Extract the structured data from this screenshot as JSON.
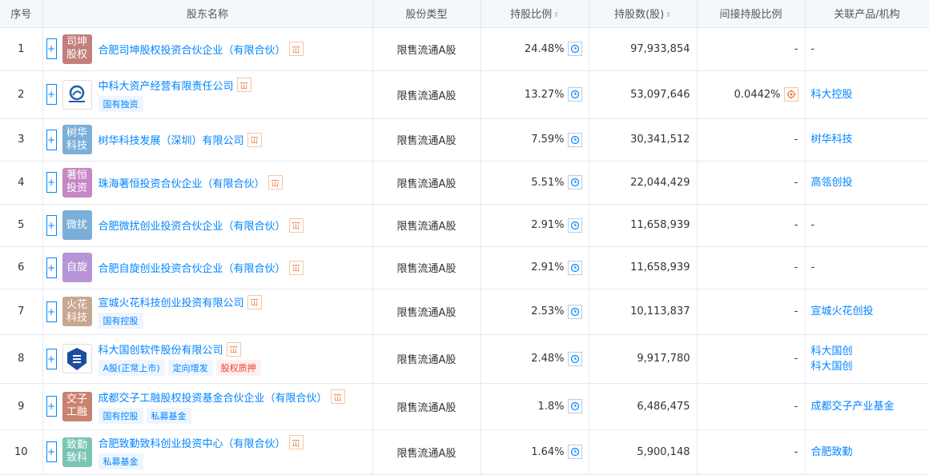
{
  "headers": {
    "idx": "序号",
    "name": "股东名称",
    "type": "股份类型",
    "ratio": "持股比例",
    "shares": "持股数(股)",
    "indirect": "间接持股比例",
    "products": "关联产品/机构"
  },
  "sort_glyph": "⇕",
  "hm_glyph": "冚",
  "rows": [
    {
      "idx": "1",
      "logo": "司坤股权",
      "logo_color": "#c47f7c",
      "name": "合肥司坤股权投资合伙企业（有限合伙）",
      "tags": [],
      "type": "限售流通A股",
      "ratio": "24.48%",
      "shares": "97,933,854",
      "indirect": "-",
      "products": [
        "-"
      ],
      "product_link": false
    },
    {
      "idx": "2",
      "logo": "",
      "logo_image": "ustc-logo-icon",
      "name": "中科大资产经营有限责任公司",
      "tags": [
        "国有独资"
      ],
      "type": "限售流通A股",
      "ratio": "13.27%",
      "shares": "53,097,646",
      "indirect": "0.0442%",
      "products": [
        "科大控股"
      ],
      "product_link": true
    },
    {
      "idx": "3",
      "logo": "树华科技",
      "logo_color": "#7aafd9",
      "name": "树华科技发展（深圳）有限公司",
      "tags": [],
      "type": "限售流通A股",
      "ratio": "7.59%",
      "shares": "30,341,512",
      "indirect": "-",
      "products": [
        "树华科技"
      ],
      "product_link": true
    },
    {
      "idx": "4",
      "logo": "著恒投资",
      "logo_color": "#c786c6",
      "name": "珠海著恒投资合伙企业（有限合伙）",
      "tags": [],
      "type": "限售流通A股",
      "ratio": "5.51%",
      "shares": "22,044,429",
      "indirect": "-",
      "products": [
        "高瓴创投"
      ],
      "product_link": true
    },
    {
      "idx": "5",
      "logo": "微扰",
      "logo_color": "#7aafd9",
      "name": "合肥微扰创业投资合伙企业（有限合伙）",
      "tags": [],
      "type": "限售流通A股",
      "ratio": "2.91%",
      "shares": "11,658,939",
      "indirect": "-",
      "products": [
        "-"
      ],
      "product_link": false
    },
    {
      "idx": "6",
      "logo": "自旋",
      "logo_color": "#b694d6",
      "name": "合肥自旋创业投资合伙企业（有限合伙）",
      "tags": [],
      "type": "限售流通A股",
      "ratio": "2.91%",
      "shares": "11,658,939",
      "indirect": "-",
      "products": [
        "-"
      ],
      "product_link": false
    },
    {
      "idx": "7",
      "logo": "火花科技",
      "logo_color": "#c9a692",
      "name": "宣城火花科技创业投资有限公司",
      "tags": [
        "国有控股"
      ],
      "type": "限售流通A股",
      "ratio": "2.53%",
      "shares": "10,113,837",
      "indirect": "-",
      "products": [
        "宣城火花创投"
      ],
      "product_link": true
    },
    {
      "idx": "8",
      "logo": "",
      "logo_image": "kd-software-logo-icon",
      "name": "科大国创软件股份有限公司",
      "tags": [
        "A股(正常上市)",
        "定向增发",
        "股权质押"
      ],
      "tag_red_index": 2,
      "type": "限售流通A股",
      "ratio": "2.48%",
      "shares": "9,917,780",
      "indirect": "-",
      "products": [
        "科大国创",
        "科大国创"
      ],
      "product_link": true
    },
    {
      "idx": "9",
      "logo": "交子工融",
      "logo_color": "#c88270",
      "name": "成都交子工融股权投资基金合伙企业（有限合伙）",
      "tags": [
        "国有控股",
        "私募基金"
      ],
      "type": "限售流通A股",
      "ratio": "1.8%",
      "shares": "6,486,475",
      "indirect": "-",
      "products": [
        "成都交子产业基金"
      ],
      "product_link": true
    },
    {
      "idx": "10",
      "logo": "致勤致科",
      "logo_color": "#7ac4b4",
      "name": "合肥致勤致科创业投资中心（有限合伙）",
      "tags": [
        "私募基金"
      ],
      "type": "限售流通A股",
      "ratio": "1.64%",
      "shares": "5,900,148",
      "indirect": "-",
      "products": [
        "合肥致勤"
      ],
      "product_link": true
    }
  ]
}
